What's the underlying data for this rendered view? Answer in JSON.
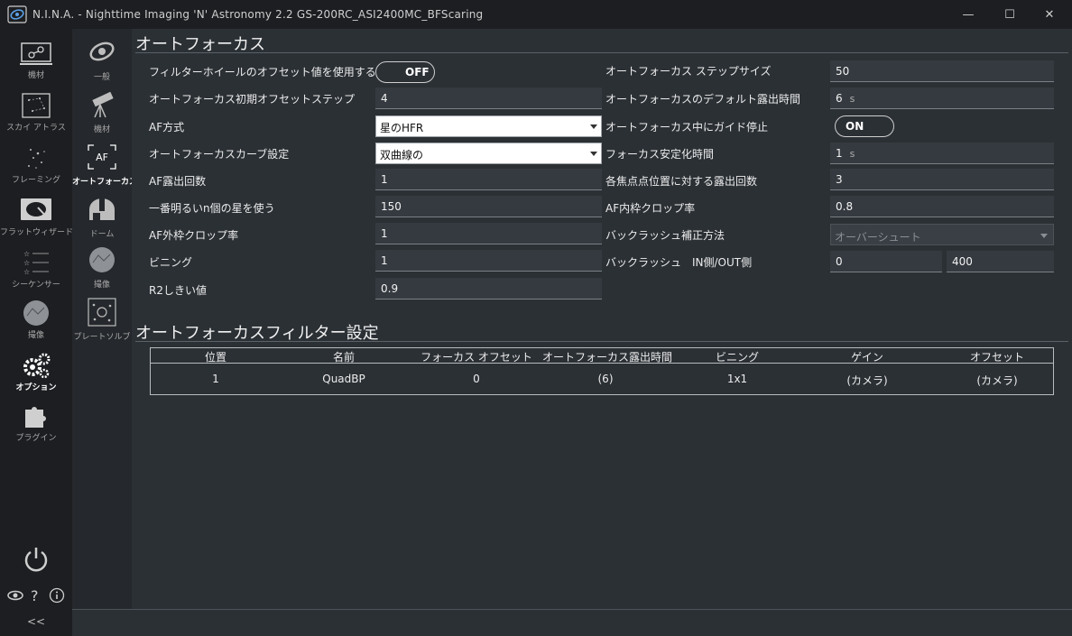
{
  "window": {
    "title": "N.I.N.A. - Nighttime Imaging 'N' Astronomy 2.2    GS-200RC_ASI2400MC_BFScaring",
    "minimize": "—",
    "maximize": "☐",
    "close": "✕"
  },
  "left_nav": {
    "items": [
      {
        "label": "機材",
        "icon": "equipment-icon"
      },
      {
        "label": "スカイ アトラス",
        "icon": "sky-atlas-icon"
      },
      {
        "label": "フレーミング",
        "icon": "framing-icon"
      },
      {
        "label": "フラットウィザード",
        "icon": "flat-wizard-icon"
      },
      {
        "label": "シーケンサー",
        "icon": "sequencer-icon"
      },
      {
        "label": "撮像",
        "icon": "imaging-icon"
      },
      {
        "label": "オプション",
        "icon": "options-gears-icon"
      },
      {
        "label": "プラグイン",
        "icon": "plugin-puzzle-icon"
      }
    ],
    "collapse": "<<"
  },
  "sub_nav": {
    "items": [
      {
        "label": "一般",
        "icon": "general-icon"
      },
      {
        "label": "機材",
        "icon": "telescope-icon"
      },
      {
        "label": "オートフォーカス",
        "icon": "autofocus-icon",
        "icon_text": "AF"
      },
      {
        "label": "ドーム",
        "icon": "dome-icon"
      },
      {
        "label": "撮像",
        "icon": "imaging-icon"
      },
      {
        "label": "プレートソルブ",
        "icon": "plate-solve-icon"
      }
    ]
  },
  "autofocus": {
    "title": "オートフォーカス",
    "left": {
      "use_filter_offsets": {
        "label": "フィルターホイールのオフセット値を使用する。",
        "value": "OFF"
      },
      "initial_offset_steps": {
        "label": "オートフォーカス初期オフセットステップ",
        "value": "4"
      },
      "af_method": {
        "label": "AF方式",
        "value": "星のHFR"
      },
      "curve_fitting": {
        "label": "オートフォーカスカーブ設定",
        "value": "双曲線の"
      },
      "exposures_per_point": {
        "label": "AF露出回数",
        "value": "1"
      },
      "use_brightest_n": {
        "label": "一番明るいn個の星を使う",
        "value": "150"
      },
      "outer_crop": {
        "label": "AF外枠クロップ率",
        "value": "1"
      },
      "binning": {
        "label": "ビニング",
        "value": "1"
      },
      "r2_threshold": {
        "label": "R2しきい値",
        "value": "0.9"
      }
    },
    "right": {
      "step_size": {
        "label": "オートフォーカス ステップサイズ",
        "value": "50"
      },
      "default_exposure": {
        "label": "オートフォーカスのデフォルト露出時間",
        "value": "6",
        "unit": "s"
      },
      "disable_guiding": {
        "label": "オートフォーカス中にガイド停止",
        "value": "ON"
      },
      "settle_time": {
        "label": "フォーカス安定化時間",
        "value": "1",
        "unit": "s"
      },
      "exposures_per_focus_point": {
        "label": "各焦点点位置に対する露出回数",
        "value": "3"
      },
      "inner_crop": {
        "label": "AF内枠クロップ率",
        "value": "0.8"
      },
      "backlash_method": {
        "label": "バックラッシュ補正方法",
        "value": "オーバーシュート"
      },
      "backlash": {
        "label": "バックラッシュ　IN側/OUT側",
        "in": "0",
        "out": "400"
      }
    }
  },
  "filter_settings": {
    "title": "オートフォーカスフィルター設定",
    "columns": [
      "位置",
      "名前",
      "フォーカス オフセット",
      "オートフォーカス露出時間",
      "ビニング",
      "ゲイン",
      "オフセット"
    ],
    "rows": [
      [
        "1",
        "QuadBP",
        "0",
        "(6)",
        "1x1",
        "(カメラ)",
        "(カメラ)"
      ]
    ]
  },
  "colors": {
    "background": "#1c1e21",
    "panel": "#2b3035",
    "field": "#353a40",
    "accent_text": "#ffffff"
  }
}
